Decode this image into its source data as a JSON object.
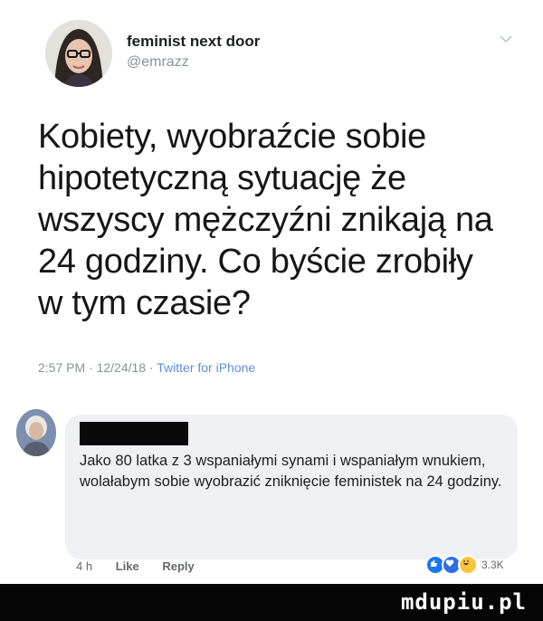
{
  "tweet": {
    "display_name": "feminist next door",
    "handle": "@emrazz",
    "text_lines": [
      "Kobiety, wyobraźcie sobie",
      "hipotetyczną sytuację że",
      "wszyscy mężczyźni znikają na",
      "24 godziny. Co byście zrobiły",
      "w tym czasie?"
    ],
    "timestamp": "2:57 PM · 12/24/18 · ",
    "source": "Twitter for iPhone",
    "icons": {
      "menu": "chevron-down-icon"
    }
  },
  "comment": {
    "text": "Jako 80 latka z 3 wspaniałymi synami i wspaniałym wnukiem, wolałabym sobie wyobrazić zniknięcie feministek na 24 godziny.",
    "age": "4 h",
    "like_label": "Like",
    "reply_label": "Reply",
    "reaction_count": "3.3K",
    "reactions": [
      "like",
      "love",
      "haha"
    ]
  },
  "watermark": "mdupiu.pl",
  "colors": {
    "footer_bg": "#050505",
    "bubble_bg": "#eef0f3",
    "meta_gray": "#8a9199",
    "source_blue": "#5b8fd6",
    "like_blue": "#1877f2"
  }
}
